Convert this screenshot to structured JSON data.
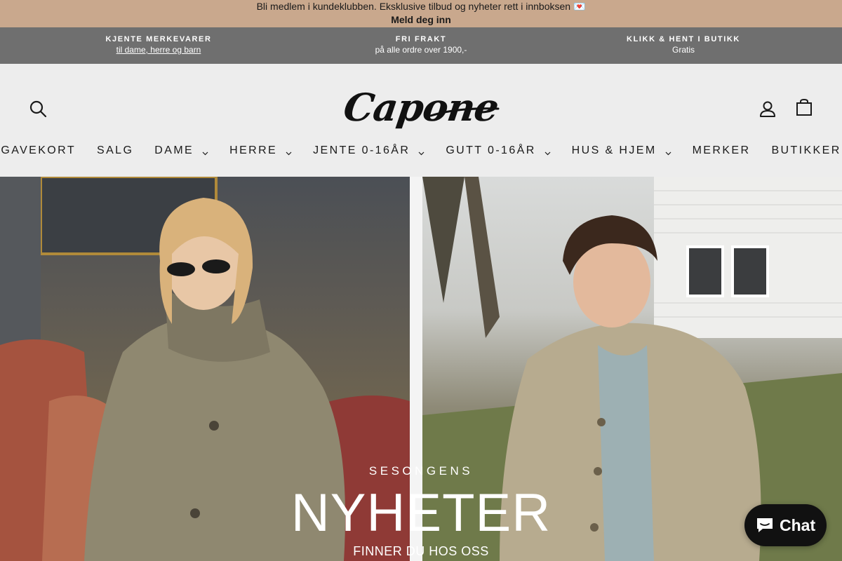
{
  "announcement": {
    "text": "Bli medlem i kundeklubben. Eksklusive tilbud og nyheter rett i innboksen 💌",
    "cta": "Meld deg inn"
  },
  "usp": [
    {
      "title": "KJENTE MERKEVARER",
      "sub": "til dame, herre og barn"
    },
    {
      "title": "FRI FRAKT",
      "sub": "på alle ordre over 1900,-"
    },
    {
      "title": "KLIKK & HENT I BUTIKK",
      "sub": "Gratis"
    }
  ],
  "header": {
    "logo_text": "Capone",
    "icons": {
      "search": "search-icon",
      "account": "account-icon",
      "cart": "cart-icon"
    }
  },
  "nav": [
    {
      "label": "GAVEKORT",
      "dropdown": false
    },
    {
      "label": "SALG",
      "dropdown": false
    },
    {
      "label": "DAME",
      "dropdown": true
    },
    {
      "label": "HERRE",
      "dropdown": true
    },
    {
      "label": "JENTE 0-16ÅR",
      "dropdown": true
    },
    {
      "label": "GUTT 0-16ÅR",
      "dropdown": true
    },
    {
      "label": "HUS & HJEM",
      "dropdown": true
    },
    {
      "label": "MERKER",
      "dropdown": false
    },
    {
      "label": "BUTIKKER",
      "dropdown": false
    }
  ],
  "hero": {
    "eyebrow": "SESONGENS",
    "title": "NYHETER",
    "subtitle": "FINNER DU HOS OSS"
  },
  "chat": {
    "label": "Chat"
  },
  "colors": {
    "announcement_bg": "#c9a88d",
    "usp_bg": "#6f6f6f",
    "header_bg": "#ededed",
    "chat_bg": "#111111"
  }
}
